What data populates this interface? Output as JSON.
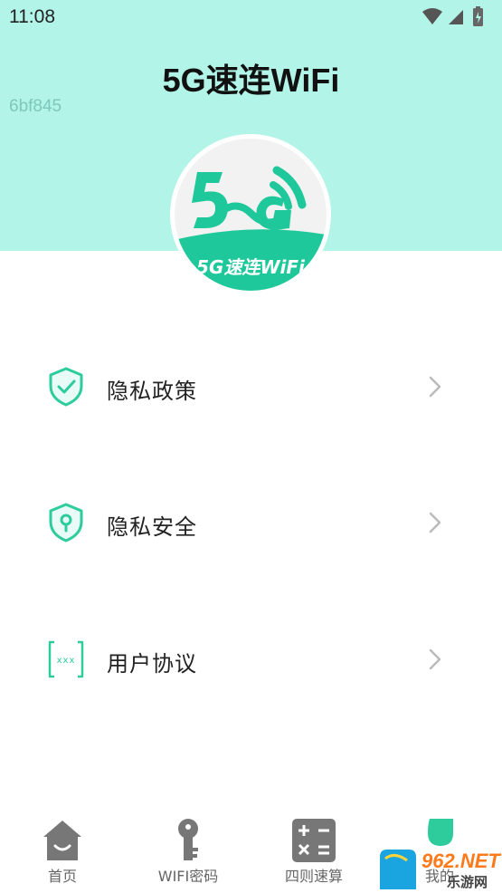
{
  "status_bar": {
    "time": "11:08"
  },
  "header": {
    "title": "5G速连WiFi",
    "code_text": "6bf845",
    "logo_text": "5G速连WiFi",
    "background_color": "#b2f4e8",
    "accent_color": "#1ec89b"
  },
  "menu": {
    "items": [
      {
        "label": "隐私政策",
        "icon": "shield-check-icon"
      },
      {
        "label": "隐私安全",
        "icon": "shield-keyhole-icon"
      },
      {
        "label": "用户协议",
        "icon": "document-xxx-icon"
      }
    ]
  },
  "tabbar": {
    "tabs": [
      {
        "label": "首页",
        "icon": "home-icon"
      },
      {
        "label": "WIFI密码",
        "icon": "key-icon"
      },
      {
        "label": "四则速算",
        "icon": "calculator-icon"
      },
      {
        "label": "我的",
        "icon": "profile-icon",
        "active": true
      }
    ]
  },
  "watermark": {
    "brand": "962.NET",
    "site": "乐游网"
  }
}
